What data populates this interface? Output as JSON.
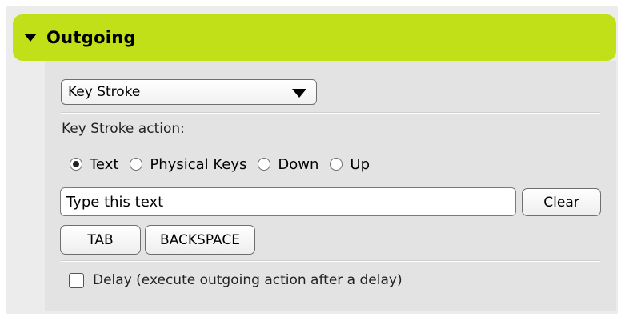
{
  "section": {
    "title": "Outgoing"
  },
  "action_select": {
    "selected": "Key Stroke"
  },
  "keystroke": {
    "label": "Key Stroke action:",
    "modes": [
      {
        "label": "Text",
        "selected": true
      },
      {
        "label": "Physical Keys",
        "selected": false
      },
      {
        "label": "Down",
        "selected": false
      },
      {
        "label": "Up",
        "selected": false
      }
    ]
  },
  "text_input": {
    "value": "Type this text"
  },
  "buttons": {
    "clear": "Clear",
    "tab": "TAB",
    "backspace": "BACKSPACE"
  },
  "delay": {
    "label": "Delay (execute outgoing action after a delay)",
    "checked": false
  },
  "colors": {
    "header_accent": "#c2e018"
  }
}
